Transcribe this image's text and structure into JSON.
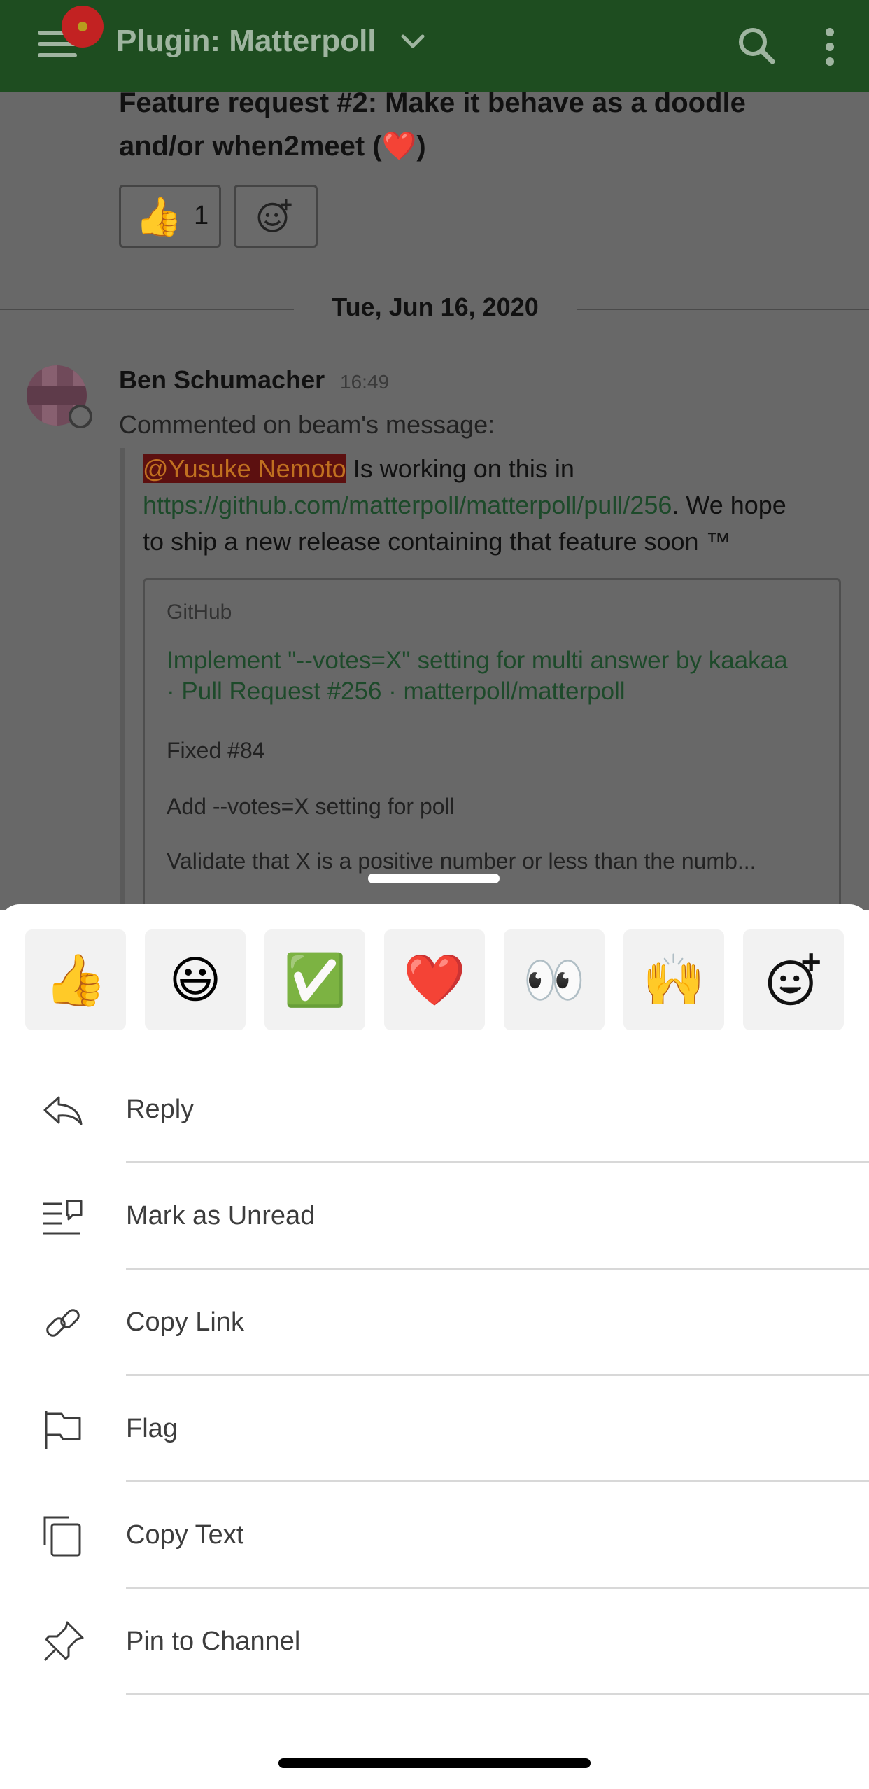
{
  "header": {
    "channel_title": "Plugin: Matterpoll",
    "bg_color": "#1e4d20"
  },
  "previous_post": {
    "text": "Feature request #2: Make it behave as a doodle and/or when2meet (❤️)",
    "reactions": [
      {
        "emoji": "👍",
        "count": "1"
      }
    ]
  },
  "date_separator": "Tue, Jun 16, 2020",
  "post": {
    "author": "Ben Schumacher",
    "time": "16:49",
    "subtitle": "Commented on beam's message:",
    "mention": "@Yusuke Nemoto",
    "text_before_link": " Is working on this in ",
    "link": "https://github.com/matterpoll/matterpoll/pull/256",
    "text_after_link": ". We hope to ship a new release containing that feature soon ™",
    "og_card": {
      "site": "GitHub",
      "title": "Implement \"--votes=X\" setting for multi answer by kaakaa · Pull Request #256 · matterpoll/matterpoll",
      "desc_lines": [
        "Fixed #84",
        "Add --votes=X setting for poll",
        "Validate that X is a positive number or less than the numb..."
      ]
    }
  },
  "sheet": {
    "quick_reactions": [
      {
        "emoji": "👍",
        "icon": "thumbs-up"
      },
      {
        "emoji": "😃",
        "icon": "smiley"
      },
      {
        "emoji": "✅",
        "icon": "white-check-mark"
      },
      {
        "emoji": "❤️",
        "icon": "heart"
      },
      {
        "emoji": "👀",
        "icon": "eyes"
      },
      {
        "emoji": "🙌",
        "icon": "raised-hands"
      },
      {
        "emoji": "",
        "icon": "add-reaction-icon"
      }
    ],
    "menu": [
      {
        "label": "Reply",
        "icon": "reply-icon"
      },
      {
        "label": "Mark as Unread",
        "icon": "mark-unread-icon"
      },
      {
        "label": "Copy Link",
        "icon": "link-icon"
      },
      {
        "label": "Flag",
        "icon": "flag-icon"
      },
      {
        "label": "Copy Text",
        "icon": "copy-icon"
      },
      {
        "label": "Pin to Channel",
        "icon": "pin-icon"
      }
    ]
  }
}
